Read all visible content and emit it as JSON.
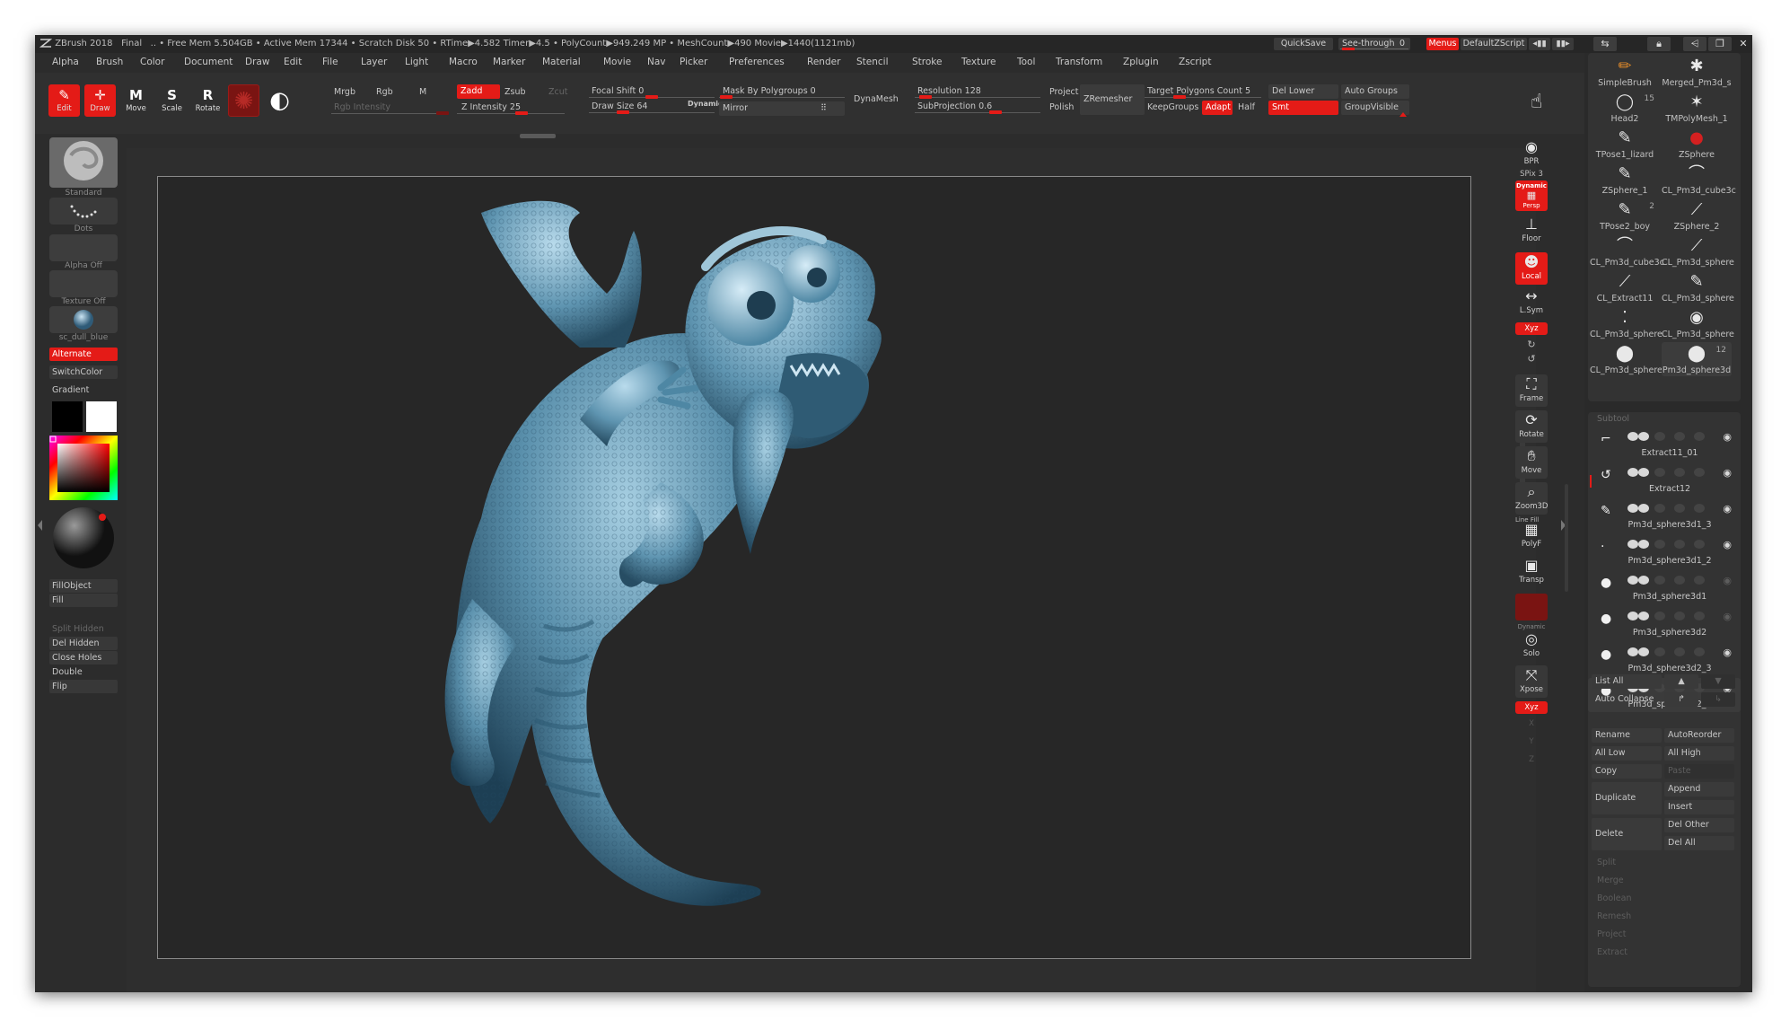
{
  "title": {
    "app": "ZBrush 2018",
    "doc": "Final",
    "stats": ".. • Free Mem 5.504GB • Active Mem 17344 • Scratch Disk 50 • RTime▶4.582 Timer▶4.5 • PolyCount▶949.249 MP • MeshCount▶490 Movie▶1440(1121mb)",
    "quicksave": "QuickSave",
    "seethrough": "See-through",
    "seethrough_value": "0",
    "menus": "Menus",
    "zscript": "DefaultZScript"
  },
  "menubar": [
    "Alpha",
    "Brush",
    "Color",
    "Document",
    "Draw",
    "Edit",
    "File",
    "Layer",
    "Light",
    "Macro",
    "Marker",
    "Material",
    "Movie",
    "Nav",
    "Picker",
    "Preferences",
    "Render",
    "Stencil",
    "Stroke",
    "Texture",
    "Tool",
    "Transform",
    "Zplugin",
    "Zscript"
  ],
  "tools": {
    "edit": "Edit",
    "draw": "Draw",
    "move": "Move",
    "scale": "Scale",
    "rotate": "Rotate"
  },
  "draw_options": {
    "mrgb": "Mrgb",
    "rgb": "Rgb",
    "m": "M",
    "rgb_intensity": "Rgb Intensity",
    "zadd": "Zadd",
    "zsub": "Zsub",
    "zcut": "Zcut",
    "z_intensity": "Z Intensity 25",
    "focal_shift": "Focal Shift 0",
    "draw_size": "Draw Size 64",
    "dynamic": "Dynamic",
    "mask_by_polygroups": "Mask By Polygroups 0",
    "mirror": "Mirror",
    "dynamesh": "DynaMesh",
    "resolution": "Resolution 128",
    "subprojection": "SubProjection 0.6",
    "project": "Project",
    "polish": "Polish",
    "zremesher": "ZRemesher",
    "target_polygons": "Target Polygons Count 5",
    "keepgroups": "KeepGroups",
    "adapt": "Adapt",
    "half": "Half",
    "del_lower": "Del Lower",
    "smt": "Smt",
    "auto_groups": "Auto Groups",
    "groupvisible": "GroupVisible"
  },
  "left_shelf": {
    "brush": "Standard",
    "stroke": "Dots",
    "alpha": "Alpha Off",
    "texture": "Texture Off",
    "material": "sc_dull_blue",
    "alternate": "Alternate",
    "switchcolor": "SwitchColor",
    "gradient": "Gradient",
    "fillobject": "FillObject",
    "fill": "Fill",
    "split_hidden": "Split Hidden",
    "del_hidden": "Del Hidden",
    "close_holes": "Close Holes",
    "double": "Double",
    "flip": "Flip",
    "colors": {
      "main": "#000000",
      "secondary": "#ffffff"
    }
  },
  "right_shelf": {
    "bpr": "BPR",
    "spix": "SPix 3",
    "dynamic": "Dynamic",
    "persp": "Persp",
    "floor": "Floor",
    "local": "Local",
    "lsym": "L.Sym",
    "xyz": "Xyz",
    "frame": "Frame",
    "rotate": "Rotate",
    "move": "Move",
    "zoom3d": "Zoom3D",
    "line_fill": "Line Fill",
    "polyf": "PolyF",
    "transp": "Transp",
    "dynamic2": "Dynamic",
    "solo": "Solo",
    "xpose": "Xpose",
    "xyz2": "Xyz",
    "x": "X",
    "y": "Y",
    "z": "Z"
  },
  "tool_palette": {
    "items": [
      {
        "name": "SimpleBrush"
      },
      {
        "name": "Merged_Pm3d_s"
      },
      {
        "name": "Head2",
        "badge": "15"
      },
      {
        "name": "TMPolyMesh_1"
      },
      {
        "name": "TPose1_lizard"
      },
      {
        "name": "ZSphere"
      },
      {
        "name": "ZSphere_1"
      },
      {
        "name": "CL_Pm3d_cube3c"
      },
      {
        "name": "TPose2_boy",
        "badge": "2"
      },
      {
        "name": "ZSphere_2"
      },
      {
        "name": "CL_Pm3d_cube3c"
      },
      {
        "name": "CL_Pm3d_sphere"
      },
      {
        "name": "CL_Extract11"
      },
      {
        "name": "CL_Pm3d_sphere"
      },
      {
        "name": "CL_Pm3d_sphere"
      },
      {
        "name": "CL_Pm3d_sphere"
      },
      {
        "name": "CL_Pm3d_sphere"
      },
      {
        "name": "Pm3d_sphere3d",
        "badge": "12"
      }
    ]
  },
  "subtool": {
    "header": "Subtool",
    "items": [
      "Extract11_01",
      "Extract12",
      "Pm3d_sphere3d1_3",
      "Pm3d_sphere3d1_2",
      "Pm3d_sphere3d1",
      "Pm3d_sphere3d2",
      "Pm3d_sphere3d2_3",
      "Pm3d_sphere3d2_2"
    ],
    "list_all": "List All",
    "auto_collapse": "Auto Collapse",
    "rename": "Rename",
    "autoreorder": "AutoReorder",
    "all_low": "All Low",
    "all_high": "All High",
    "copy": "Copy",
    "paste": "Paste",
    "duplicate": "Duplicate",
    "append": "Append",
    "insert": "Insert",
    "delete": "Delete",
    "del_other": "Del Other",
    "del_all": "Del All",
    "split": "Split",
    "merge": "Merge",
    "boolean": "Boolean",
    "remesh": "Remesh",
    "project": "Project",
    "extract": "Extract"
  },
  "accent": "#e41b17",
  "model_color": "#5a90ac"
}
